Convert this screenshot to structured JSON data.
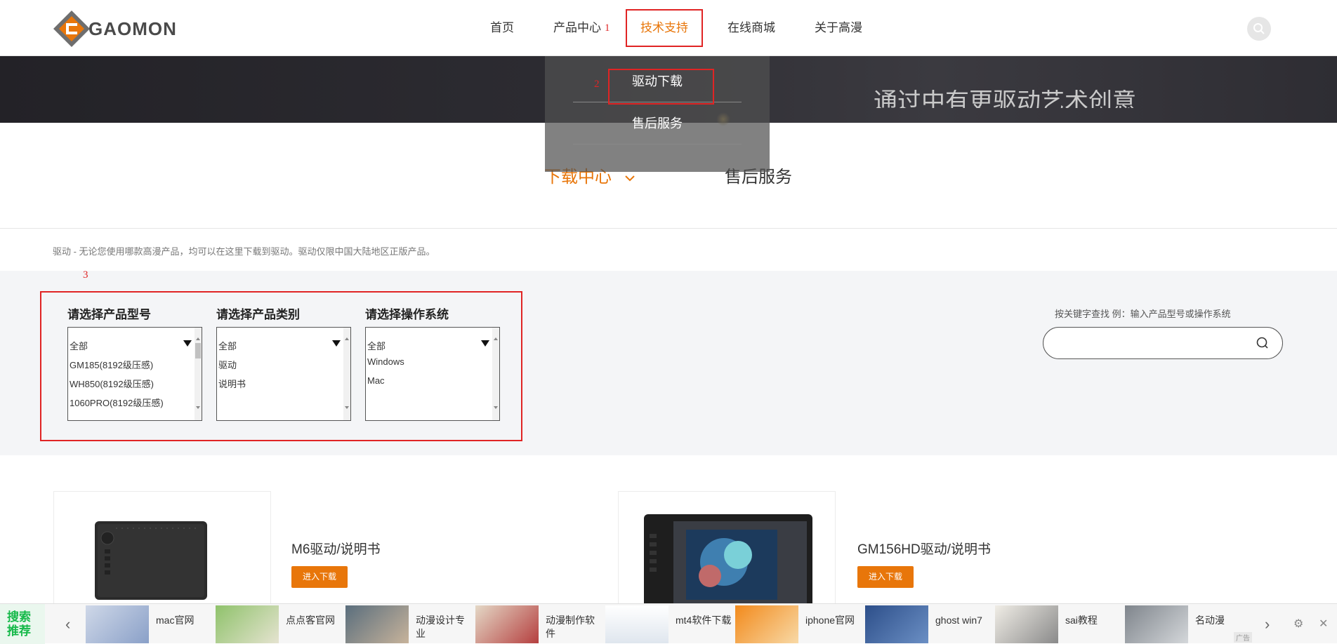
{
  "logo": {
    "text": "GAOMON"
  },
  "nav": {
    "items": [
      "首页",
      "产品中心",
      "技术支持",
      "在线商城",
      "关于高漫"
    ],
    "active_index": 2,
    "annotation_1": "1"
  },
  "banner": {
    "text": "通过中有更驱动艺术创意"
  },
  "dropdown": {
    "items": [
      "驱动下载",
      "售后服务"
    ],
    "annotation_2": "2"
  },
  "tabs": {
    "download": "下载中心",
    "service": "售后服务"
  },
  "description": "驱动 - 无论您使用哪款高漫产品，均可以在这里下载到驱动。驱动仅限中国大陆地区正版产品。",
  "filter": {
    "annotation_3": "3",
    "model": {
      "label": "请选择产品型号",
      "options": [
        "全部",
        "GM185(8192级压感)",
        "WH850(8192级压感)",
        "1060PRO(8192级压感)"
      ]
    },
    "category": {
      "label": "请选择产品类别",
      "options": [
        "全部",
        "驱动",
        "说明书"
      ]
    },
    "os": {
      "label": "请选择操作系统",
      "options": [
        "全部",
        "Windows",
        "Mac"
      ]
    }
  },
  "keyword": {
    "label": "按关键字查找  例：输入产品型号或操作系统",
    "value": ""
  },
  "products": [
    {
      "name": "M6驱动/说明书",
      "button": "进入下载"
    },
    {
      "name": "GM156HD驱动/说明书",
      "button": "进入下载"
    }
  ],
  "adbar": {
    "head": [
      "搜索",
      "推荐"
    ],
    "items": [
      "mac官网",
      "点点客官网",
      "动漫设计专业",
      "动漫制作软件",
      "mt4软件下载",
      "iphone官网",
      "ghost win7",
      "sai教程",
      "名动漫"
    ],
    "badge": "广告"
  },
  "colors": {
    "accent": "#e8760a",
    "annotation": "#e02424",
    "ad_green": "#16b94a"
  }
}
